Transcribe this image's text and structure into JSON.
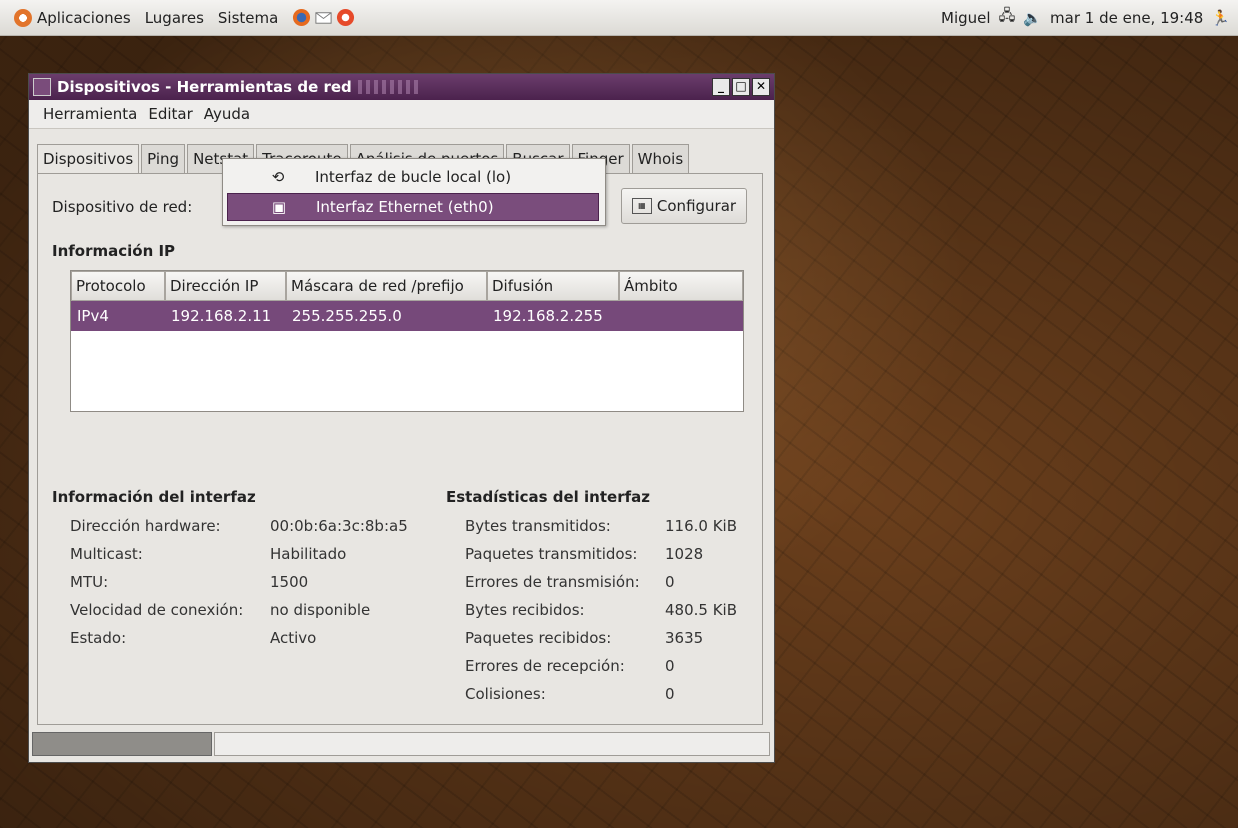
{
  "panel": {
    "menus": [
      "Aplicaciones",
      "Lugares",
      "Sistema"
    ],
    "user": "Miguel",
    "datetime": "mar  1 de ene, 19:48"
  },
  "window": {
    "title": "Dispositivos - Herramientas de red",
    "menubar": [
      "Herramienta",
      "Editar",
      "Ayuda"
    ],
    "tabs": [
      "Dispositivos",
      "Ping",
      "Netstat",
      "Traceroute",
      "Análisis de puertos",
      "Buscar",
      "Finger",
      "Whois"
    ],
    "device_label": "Dispositivo de red:",
    "dropdown_options": [
      "Interfaz de bucle local (lo)",
      "Interfaz Ethernet (eth0)"
    ],
    "configure_button": "Configurar",
    "ip_heading": "Información IP",
    "table": {
      "headers": [
        "Protocolo",
        "Dirección IP",
        "Máscara de red /prefijo",
        "Difusión",
        "Ámbito"
      ],
      "rows": [
        [
          "IPv4",
          "192.168.2.11",
          "255.255.255.0",
          "192.168.2.255",
          ""
        ]
      ]
    },
    "iface_info": {
      "heading": "Información del interfaz",
      "rows": [
        {
          "label": "Dirección hardware:",
          "value": "00:0b:6a:3c:8b:a5"
        },
        {
          "label": "Multicast:",
          "value": "Habilitado"
        },
        {
          "label": "MTU:",
          "value": "1500"
        },
        {
          "label": "Velocidad de conexión:",
          "value": "no disponible"
        },
        {
          "label": "Estado:",
          "value": "Activo"
        }
      ]
    },
    "iface_stats": {
      "heading": "Estadísticas del interfaz",
      "rows": [
        {
          "label": "Bytes transmitidos:",
          "value": "116.0 KiB"
        },
        {
          "label": "Paquetes transmitidos:",
          "value": "1028"
        },
        {
          "label": "Errores de transmisión:",
          "value": "0"
        },
        {
          "label": "Bytes recibidos:",
          "value": "480.5 KiB"
        },
        {
          "label": "Paquetes recibidos:",
          "value": "3635"
        },
        {
          "label": "Errores de recepción:",
          "value": "0"
        },
        {
          "label": "Colisiones:",
          "value": "0"
        }
      ]
    }
  },
  "colors": {
    "titlebar": "#4b224d",
    "selection": "#76497a"
  }
}
